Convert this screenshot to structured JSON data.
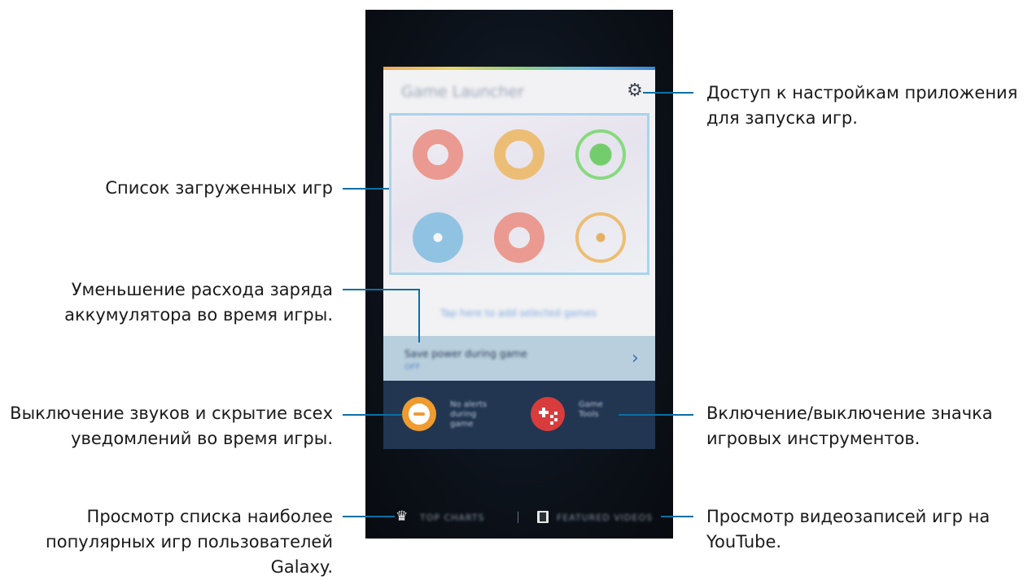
{
  "callouts": {
    "settings": "Доступ к настройкам приложения\nдля запуска игр.",
    "game_list": "Список загруженных игр",
    "power_saving": "Уменьшение расхода заряда\nаккумулятора во время игры.",
    "no_alerts": "Выключение звуков и скрытие всех\nуведомлений во время игры.",
    "game_tools": "Включение/выключение значка\nигровых инструментов.",
    "top_charts": "Просмотр списка наиболее\nпопулярных игр пользователей\nGalaxy.",
    "featured_videos": "Просмотр видеозаписей игр на\nYouTube."
  },
  "screen": {
    "app_title": "Game Launcher",
    "add_games_link": "Tap here to add selected games",
    "power_label": "Save power during game",
    "power_state": "OFF",
    "no_alerts_label": "No alerts\nduring game",
    "game_tools_label": "Game\nTools",
    "top_charts_label": "TOP CHARTS",
    "featured_videos_label": "FEATURED VIDEOS"
  },
  "icons": {
    "settings": "gear-icon",
    "no_alerts": "minus-circle-icon",
    "game_tools": "gamepad-icon",
    "top_charts": "crown-icon",
    "featured_videos": "film-icon",
    "chevron": "chevron-right-icon"
  },
  "colors": {
    "callout_line": "#0b6fa4",
    "highlight_border": "#a9d3ec",
    "no_alerts_button": "#ef9b2f",
    "game_tools_button": "#d93c3c",
    "bottom_panel": "#223651",
    "game_icons": [
      "#e98e85",
      "#e9b76a",
      "#7fd67a",
      "#89bfe0",
      "#e98e85",
      "#e9b76a"
    ]
  }
}
